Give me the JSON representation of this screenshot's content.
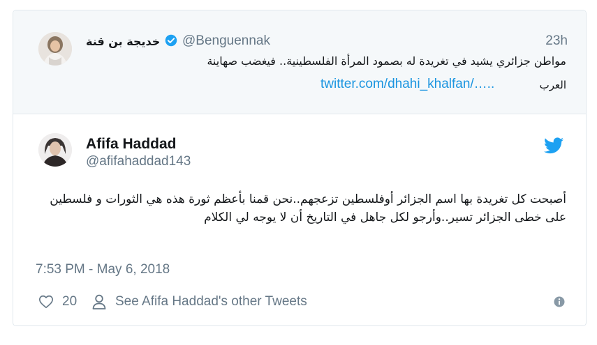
{
  "quoted_tweet": {
    "name": "خديجة بن قنة",
    "handle": "@Benguennak",
    "time": "23h",
    "text": "مواطن جزائري يشيد في تغريدة له بصمود المرأة الفلسطينية.. فيغضب صهاينة",
    "text_tail": "العرب",
    "link": "twitter.com/dhahi_khalfan/….."
  },
  "tweet": {
    "name": "Afifa Haddad",
    "handle": "@afifahaddad143",
    "text": "أصبحت كل تغريدة بها اسم الجزائر أوفلسطين تزعجهم..نحن قمنا بأعظم ثورة هذه هي الثورات  و فلسطين على خطى الجزائر تسير..وأرجو لكل جاهل في التاريخ أن لا  يوجه لي الكلام",
    "timestamp": "7:53 PM - May 6, 2018",
    "likes": "20",
    "other_tweets_label": "See Afifa Haddad's other Tweets"
  },
  "colors": {
    "twitter_blue": "#1da1f2",
    "link_blue": "#1b95e0",
    "secondary_text": "#657786",
    "primary_text": "#14171a",
    "quoted_background": "#f5f8fa"
  },
  "icons": {
    "verified": "verified-badge-icon",
    "brand": "twitter-bird-icon",
    "like": "heart-icon",
    "profile": "person-icon",
    "info": "info-icon"
  }
}
